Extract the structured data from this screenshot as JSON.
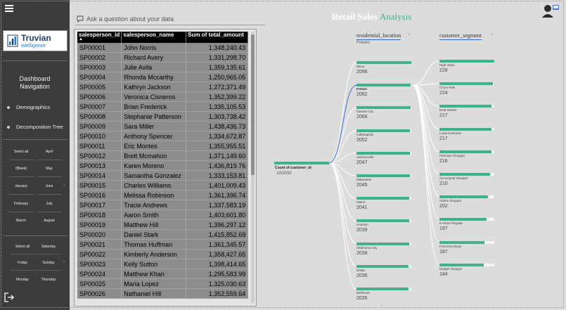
{
  "sidebar": {
    "brand_name": "Truvian",
    "brand_sub": "intelligence",
    "dashboard_nav_line1": "Dashboard",
    "dashboard_nav_line2": "Navigation",
    "nav_items": [
      "Demographics",
      "Decomposition Tree"
    ],
    "slicers_group1": [
      "Select all",
      "April",
      "(Blank)",
      "May",
      "January",
      "June",
      "February",
      "July",
      "March",
      "August"
    ],
    "slicers_group2": [
      "Select all",
      "Saturday",
      "Friday",
      "Sunday",
      "Monday",
      "Thursday"
    ]
  },
  "qa": {
    "placeholder": "Ask a question about your data"
  },
  "table": {
    "headers": [
      "salesperson_id",
      "salesperson_name",
      "Sum of total_amount"
    ],
    "rows": [
      [
        "SP00001",
        "John Norris",
        "1,348,240.43"
      ],
      [
        "SP00002",
        "Richard Avery",
        "1,331,298.70"
      ],
      [
        "SP00003",
        "Julie Avila",
        "1,359,135.61"
      ],
      [
        "SP00004",
        "Rhonda Mccarthy",
        "1,250,965.05"
      ],
      [
        "SP00005",
        "Kathryn Jackson",
        "1,272,371.49"
      ],
      [
        "SP00006",
        "Veronica Cisneros",
        "1,352,399.22"
      ],
      [
        "SP00007",
        "Brian Frederick",
        "1,335,105.53"
      ],
      [
        "SP00008",
        "Stephanie Patterson",
        "1,303,738.42"
      ],
      [
        "SP00009",
        "Sara Miller",
        "1,438,436.73"
      ],
      [
        "SP00010",
        "Anthony Spencer",
        "1,334,672.87"
      ],
      [
        "SP00011",
        "Eric Montes",
        "1,355,955.51"
      ],
      [
        "SP00012",
        "Brett Mcmahon",
        "1,371,149.60"
      ],
      [
        "SP00013",
        "Karen Moreno",
        "1,436,819.76"
      ],
      [
        "SP00014",
        "Samantha Gonzalez",
        "1,333,153.81"
      ],
      [
        "SP00015",
        "Charles Williams",
        "1,401,009.43"
      ],
      [
        "SP00016",
        "Melissa Robinson",
        "1,361,396.74"
      ],
      [
        "SP00017",
        "Tracie Andrews",
        "1,337,583.19"
      ],
      [
        "SP00018",
        "Aaron Smith",
        "1,403,601.80"
      ],
      [
        "SP00019",
        "Matthew Hill",
        "1,396,297.12"
      ],
      [
        "SP00020",
        "Daniel Stark",
        "1,415,852.69"
      ],
      [
        "SP00021",
        "Thomas Huffman",
        "1,361,345.57"
      ],
      [
        "SP00022",
        "Kimberly Anderson",
        "1,358,427.65"
      ],
      [
        "SP00023",
        "Kelly Sutton",
        "1,398,414.65"
      ],
      [
        "SP00024",
        "Matthew Khan",
        "1,295,583.99"
      ],
      [
        "SP00025",
        "Maria Lopez",
        "1,325,030.63"
      ],
      [
        "SP00026",
        "Nathaniel Hill",
        "1,352,559.64"
      ]
    ]
  },
  "tree": {
    "title_part1": "Retail Sales",
    "title_part2": "Analysis",
    "col1_header": "residential_location",
    "col1_selected": "Fresno",
    "col2_header": "customer_segment",
    "close_glyph": "×",
    "root": {
      "label": "Count of customer_id",
      "value": "100000"
    },
    "locations": [
      {
        "label": "Mesa",
        "value": "2096",
        "fill": 1.0
      },
      {
        "label": "Fresno",
        "value": "2082",
        "fill": 0.99
      },
      {
        "label": "Kansas City",
        "value": "2068",
        "fill": 0.985
      },
      {
        "label": "Indianapolis",
        "value": "2052",
        "fill": 0.98
      },
      {
        "label": "Jacksonville",
        "value": "2047",
        "fill": 0.975
      },
      {
        "label": "Milwaukee",
        "value": "2045",
        "fill": 0.97
      },
      {
        "label": "Miami",
        "value": "2041",
        "fill": 0.965
      },
      {
        "label": "Houston",
        "value": "2039",
        "fill": 0.96
      },
      {
        "label": "Oklahoma City",
        "value": "2038",
        "fill": 0.96
      },
      {
        "label": "Dallas",
        "value": "2036",
        "fill": 0.955
      },
      {
        "label": "Baltimore",
        "value": "2035",
        "fill": 0.955
      }
    ],
    "segments": [
      {
        "label": "High Value",
        "value": "228",
        "fill": 1.0
      },
      {
        "label": "Churn Risk",
        "value": "224",
        "fill": 0.98
      },
      {
        "label": "Deal Seeker",
        "value": "217",
        "fill": 0.95
      },
      {
        "label": "Loyal Customer",
        "value": "217",
        "fill": 0.95
      },
      {
        "label": "Premium Shopper",
        "value": "216",
        "fill": 0.95
      },
      {
        "label": "Occasional Shopper",
        "value": "210",
        "fill": 0.92
      },
      {
        "label": "Online Shopper",
        "value": "202",
        "fill": 0.89
      },
      {
        "label": "In-Store Regular",
        "value": "197",
        "fill": 0.86
      },
      {
        "label": "First-time Buyer",
        "value": "187",
        "fill": 0.82
      },
      {
        "label": "Budget Shopper",
        "value": "184",
        "fill": 0.81
      }
    ]
  },
  "colors": {
    "accent": "#3db38a",
    "link_selected": "#3a6fd8",
    "sidebar": "#3c3c3c"
  }
}
